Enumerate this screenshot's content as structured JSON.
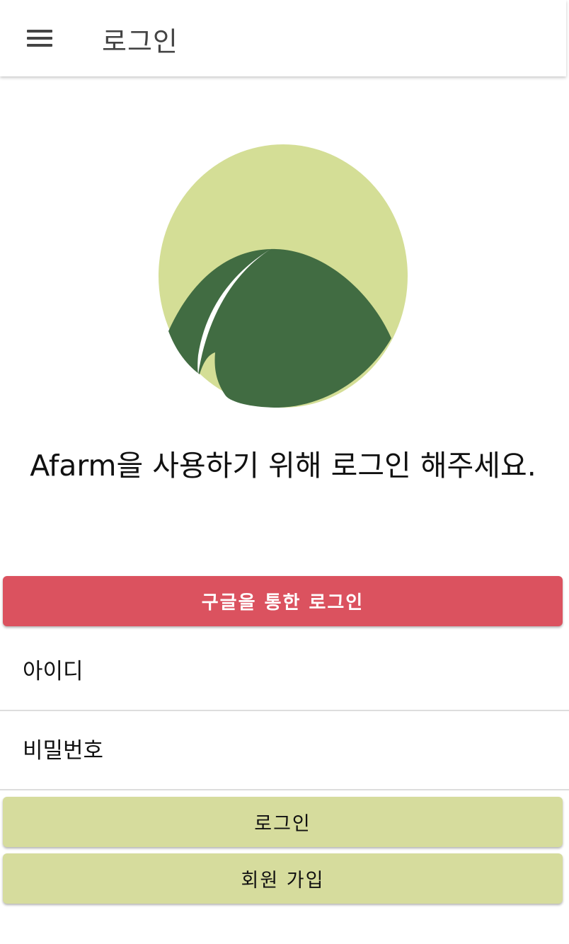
{
  "header": {
    "menu_icon": "hamburger-menu-icon",
    "title": "로그인"
  },
  "logo": {
    "icon": "leaf-logo",
    "colors": {
      "circle": "#d4de96",
      "leaf": "#416c42",
      "stripe": "#ffffff"
    }
  },
  "welcome_text": "Afarm을 사용하기 위해 로그인 해주세요.",
  "google_button": {
    "label": "구글을 통한 로그인",
    "color": "#db525f"
  },
  "form": {
    "id_placeholder": "아이디",
    "password_placeholder": "비밀번호"
  },
  "login_button": {
    "label": "로그인",
    "color": "#d6dc9d"
  },
  "signup_button": {
    "label": "회원 가입",
    "color": "#d6dc9d"
  }
}
